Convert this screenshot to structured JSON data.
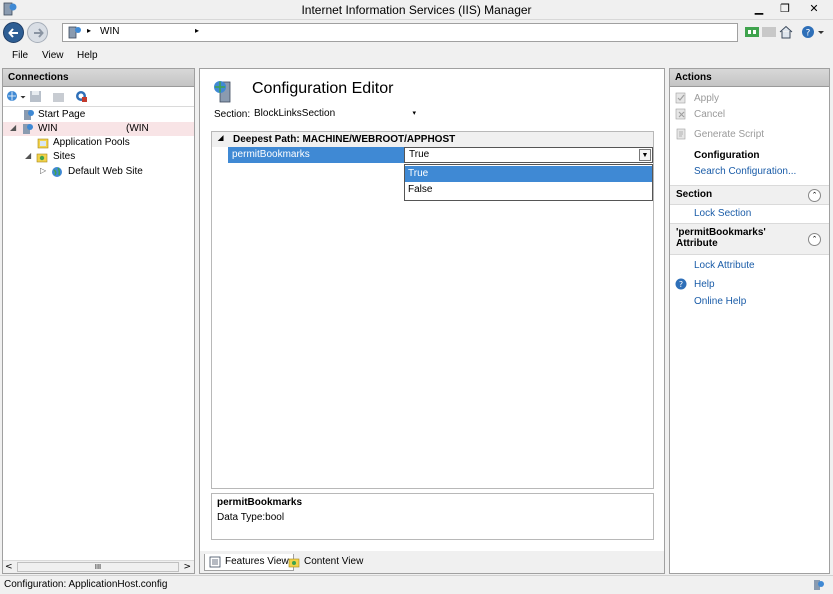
{
  "window": {
    "title": "Internet Information Services (IIS) Manager",
    "min_label": "▁",
    "max_label": "❐",
    "close_label": "✕"
  },
  "address": {
    "segment1": "WIN",
    "sep": "▸"
  },
  "menu": {
    "file": "File",
    "view": "View",
    "help": "Help"
  },
  "connections": {
    "header": "Connections",
    "tree": [
      {
        "label": "Start Page",
        "icon": "start-page-icon"
      },
      {
        "label": "WIN",
        "suffix": "(WIN",
        "icon": "server-icon",
        "expander": "◢"
      },
      {
        "label": "Application Pools",
        "icon": "app-pools-icon"
      },
      {
        "label": "Sites",
        "icon": "sites-folder-icon",
        "expander": "◢"
      },
      {
        "label": "Default Web Site",
        "icon": "globe-icon",
        "expander": "▷"
      }
    ],
    "scroll_thumb": "III",
    "scroll_left": "<",
    "scroll_right": ">"
  },
  "editor": {
    "title": "Configuration Editor",
    "section_label": "Section:",
    "section_value": "BlockLinksSection",
    "section_arrow": "▾",
    "group_expander": "◢",
    "group_title": "Deepest Path: MACHINE/WEBROOT/APPHOST",
    "property_name": "permitBookmarks",
    "property_value": "True",
    "dropdown_btn": "▼",
    "options": [
      "True",
      "False"
    ],
    "desc_title": "permitBookmarks",
    "desc_type": "Data Type:bool",
    "tabs": {
      "features": "Features View",
      "content": "Content View"
    }
  },
  "actions": {
    "header": "Actions",
    "apply": "Apply",
    "cancel": "Cancel",
    "generate_script": "Generate Script",
    "configuration": "Configuration",
    "search_configuration": "Search Configuration...",
    "section_header": "Section",
    "lock_section": "Lock Section",
    "attribute_header_line1": "'permitBookmarks'",
    "attribute_header_line2": "Attribute",
    "lock_attribute": "Lock Attribute",
    "help": "Help",
    "online_help": "Online Help",
    "collapse_glyph": "⌃"
  },
  "status": {
    "text": "Configuration: ApplicationHost.config"
  },
  "colors": {
    "selection": "#3f89d4",
    "link": "#1a5ca8",
    "disabled": "#9a9a9a",
    "tree_selected": "#f8e4e6"
  }
}
